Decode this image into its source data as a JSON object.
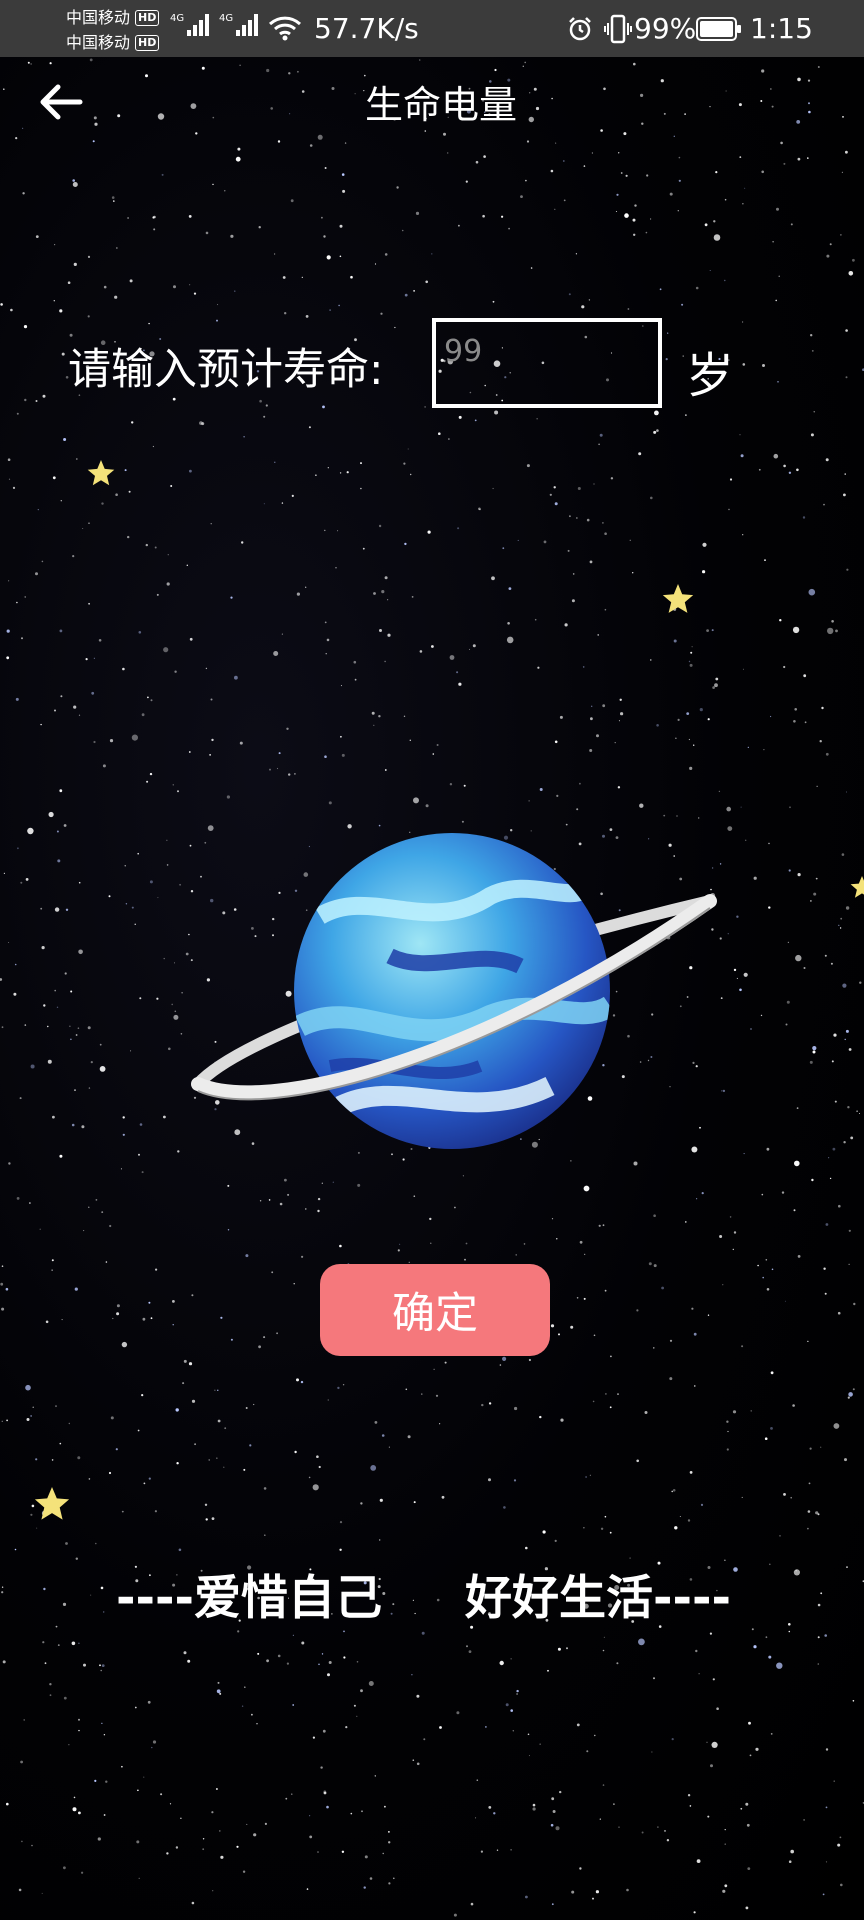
{
  "status_bar": {
    "carrier_1": "中国移动",
    "carrier_2": "中国移动",
    "hd_badge": "HD",
    "network_type": "4G",
    "net_speed": "57.7K/s",
    "battery_percent": "99%",
    "time": "1:15",
    "icons": [
      "signal-icon",
      "wifi-icon",
      "alarm-icon",
      "vibrate-icon",
      "battery-icon"
    ]
  },
  "header": {
    "title": "生命电量",
    "back_icon": "arrow-left-icon"
  },
  "form": {
    "label": "请输入预计寿命:",
    "input_value": "",
    "input_placeholder": "99",
    "unit": "岁"
  },
  "illustration": {
    "icon": "planet-icon"
  },
  "confirm_button": {
    "label": "确定",
    "color": "#f5787c"
  },
  "slogan": {
    "left": "----爱惜自己",
    "right": "好好生活----"
  },
  "colors": {
    "background": "#000000",
    "status_bar": "#3b3b3b",
    "text": "#ffffff",
    "star_yellow": "#f4e27a"
  }
}
